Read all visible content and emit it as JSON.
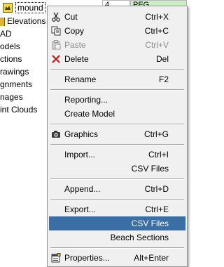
{
  "grid": {
    "cells": [
      "4",
      "PEG"
    ]
  },
  "tree": {
    "root_label": "mound",
    "nodes": [
      "Elevations",
      "AD",
      "odels",
      "ctions",
      "rawings",
      "gnments",
      "nages",
      "int Clouds"
    ]
  },
  "menu": {
    "cut": {
      "label": "Cut",
      "shortcut": "Ctrl+X"
    },
    "copy": {
      "label": "Copy",
      "shortcut": "Ctrl+C"
    },
    "paste": {
      "label": "Paste",
      "shortcut": "Ctrl+V"
    },
    "delete": {
      "label": "Delete",
      "shortcut": "Del"
    },
    "rename": {
      "label": "Rename",
      "shortcut": "F2"
    },
    "reporting": {
      "label": "Reporting..."
    },
    "create_model": {
      "label": "Create Model"
    },
    "graphics": {
      "label": "Graphics",
      "shortcut": "Ctrl+G"
    },
    "import": {
      "label": "Import...",
      "shortcut": "Ctrl+I"
    },
    "import_csv": {
      "label": "CSV Files"
    },
    "append": {
      "label": "Append...",
      "shortcut": "Ctrl+D"
    },
    "export": {
      "label": "Export...",
      "shortcut": "Ctrl+E"
    },
    "export_csv": {
      "label": "CSV Files"
    },
    "export_beach": {
      "label": "Beach Sections"
    },
    "properties": {
      "label": "Properties...",
      "shortcut": "Alt+Enter"
    }
  },
  "colors": {
    "selection": "#3a6ea5",
    "menu_background": "#f0f0f0",
    "delete_icon": "#c01818",
    "folder_icon": "#f4d840"
  }
}
